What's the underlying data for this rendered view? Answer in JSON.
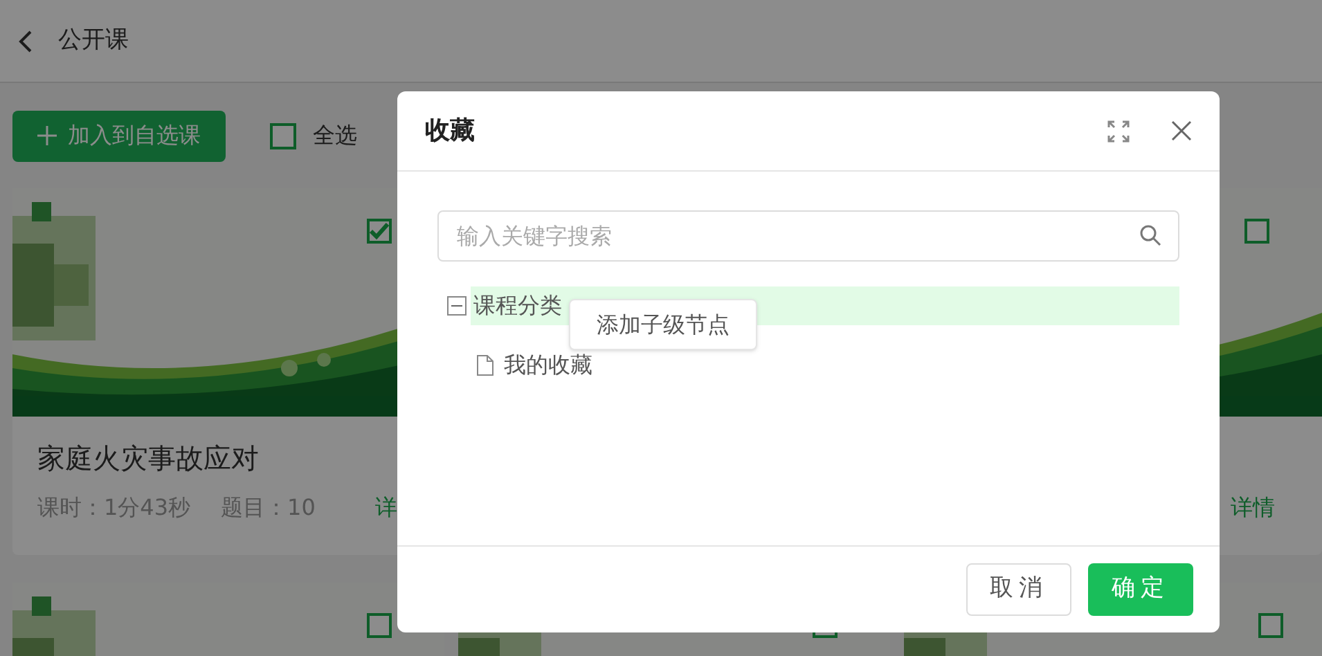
{
  "header": {
    "title": "公开课"
  },
  "toolbar": {
    "add_button": "加入到自选课",
    "select_all": {
      "label": "全选",
      "checked": false
    }
  },
  "card_rows": [
    [
      {
        "kind": "full",
        "title": "家庭火灾事故应对",
        "duration": "课时：1分43秒",
        "questions": "题目：10",
        "details": "详",
        "checked": true
      },
      {
        "kind": "covered"
      },
      {
        "kind": "full",
        "details": "详情",
        "checked": false
      }
    ],
    [
      {
        "kind": "full",
        "checked": false
      },
      {
        "kind": "full",
        "checked": false
      },
      {
        "kind": "full",
        "checked": false
      }
    ]
  ],
  "dialog": {
    "title": "收藏",
    "search": {
      "placeholder": "输入关键字搜索"
    },
    "tree": [
      {
        "label": "课程分类",
        "expanded": true,
        "selected": true,
        "children": [
          {
            "label": "我的收藏",
            "selected": false
          }
        ]
      }
    ],
    "context_menu": {
      "items": [
        "添加子级节点"
      ]
    },
    "buttons": [
      {
        "label": "取消",
        "kind": "default"
      },
      {
        "label": "确定",
        "kind": "primary"
      }
    ]
  }
}
